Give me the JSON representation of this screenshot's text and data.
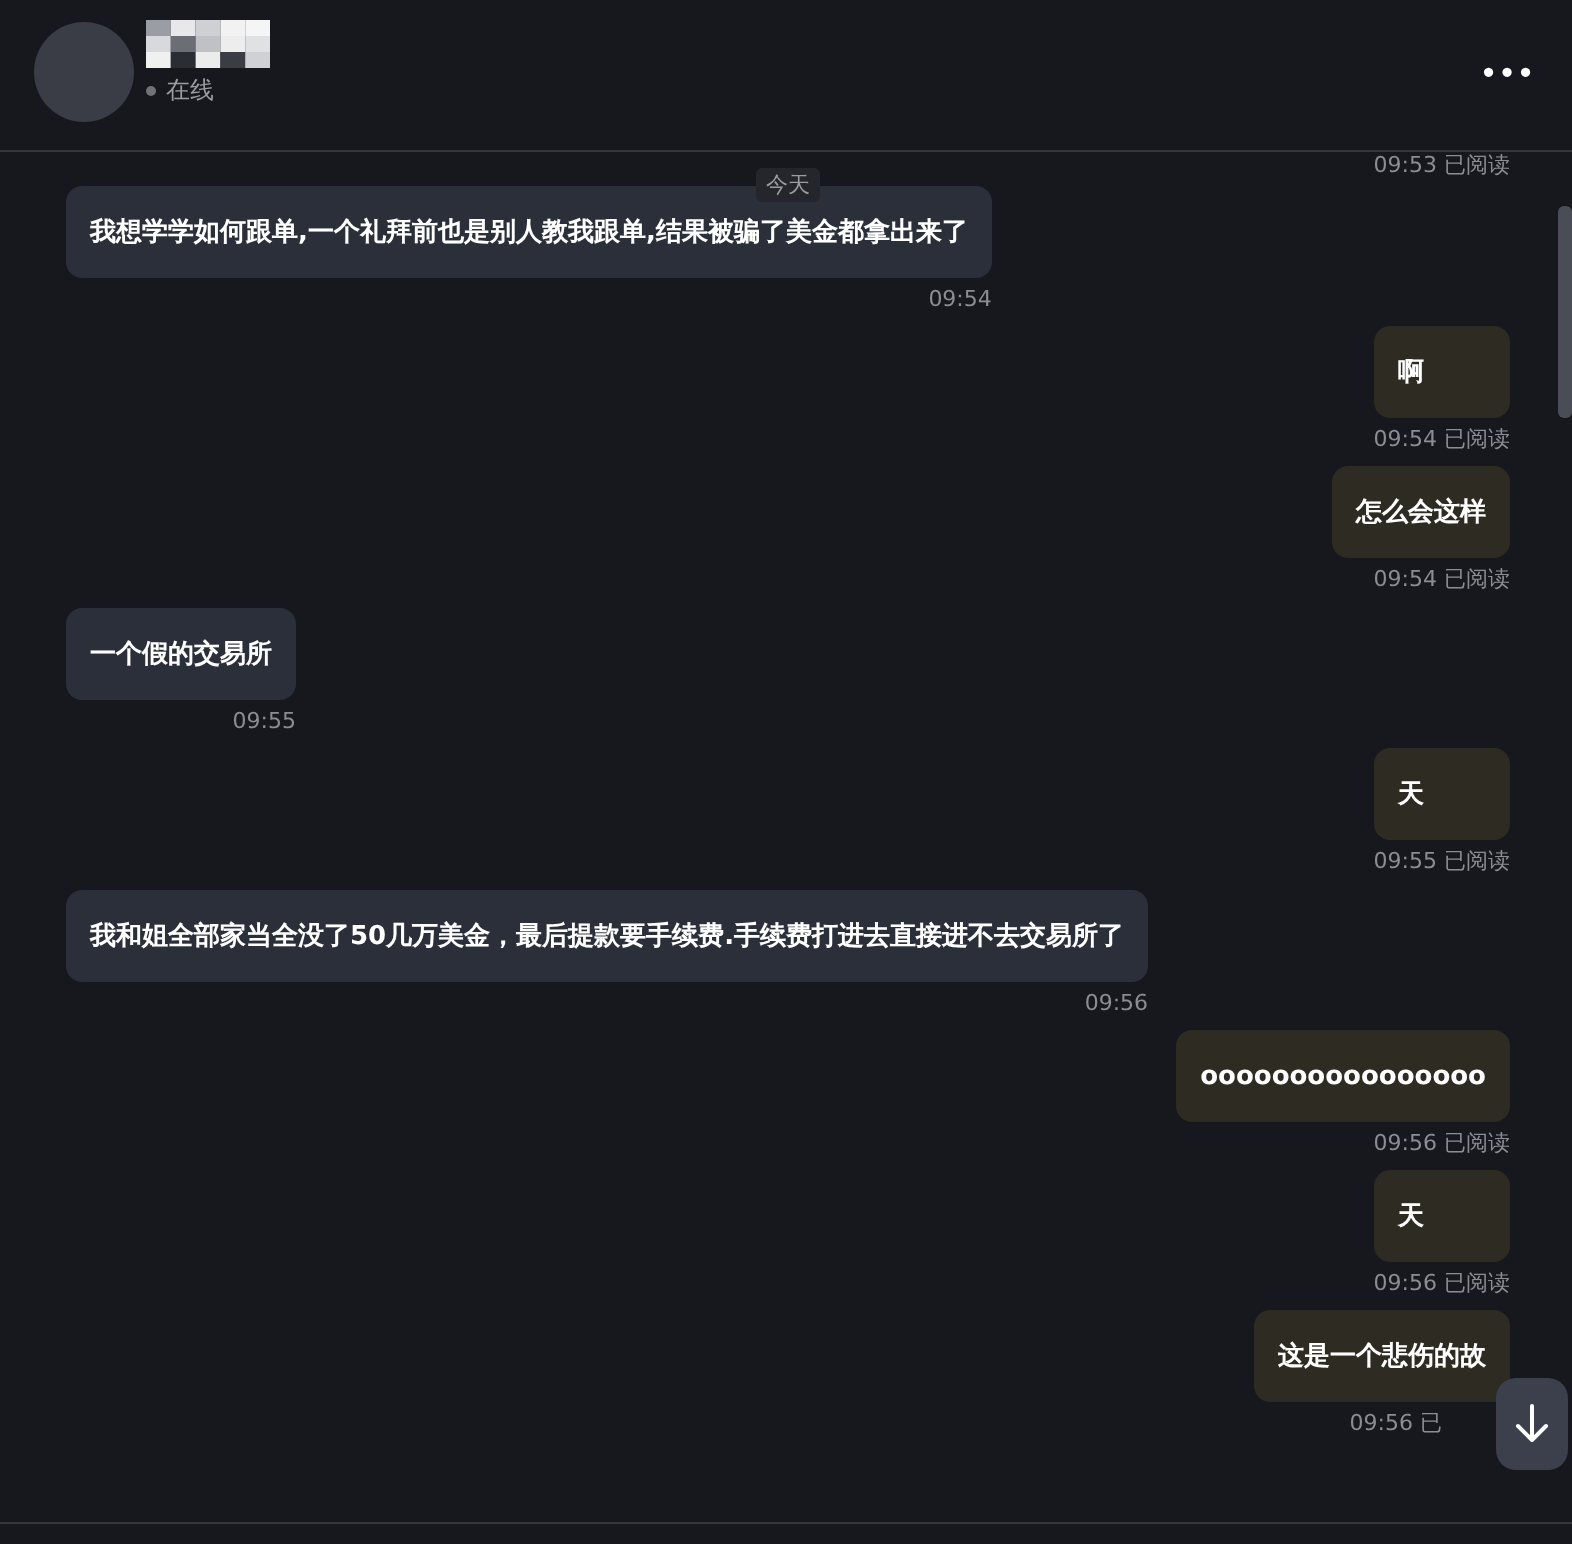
{
  "header": {
    "status": "在线",
    "menu": "•••"
  },
  "date_chip": "今天",
  "top_meta": "09:53 已阅读",
  "messages": [
    {
      "kind": "in",
      "text": "我想学学如何跟单,一个礼拜前也是别人教我跟单,结果被骗了美金都拿出来了",
      "meta": "09:54"
    },
    {
      "kind": "out",
      "text": "啊",
      "meta": "09:54 已阅读"
    },
    {
      "kind": "out",
      "text": "怎么会这样",
      "meta": "09:54 已阅读"
    },
    {
      "kind": "in",
      "text": "一个假的交易所",
      "meta": "09:55"
    },
    {
      "kind": "out",
      "text": "天",
      "meta": "09:55 已阅读"
    },
    {
      "kind": "in",
      "text": "我和姐全部家当全没了50几万美金，最后提款要手续费.手续费打进去直接进不去交易所了",
      "meta": "09:56"
    },
    {
      "kind": "out",
      "text": "oooooooooooooooo",
      "meta": "09:56 已阅读"
    },
    {
      "kind": "out",
      "text": "天",
      "meta": "09:56 已阅读"
    },
    {
      "kind": "out",
      "text": "这是一个悲伤的故",
      "meta": "09:56 已"
    }
  ]
}
